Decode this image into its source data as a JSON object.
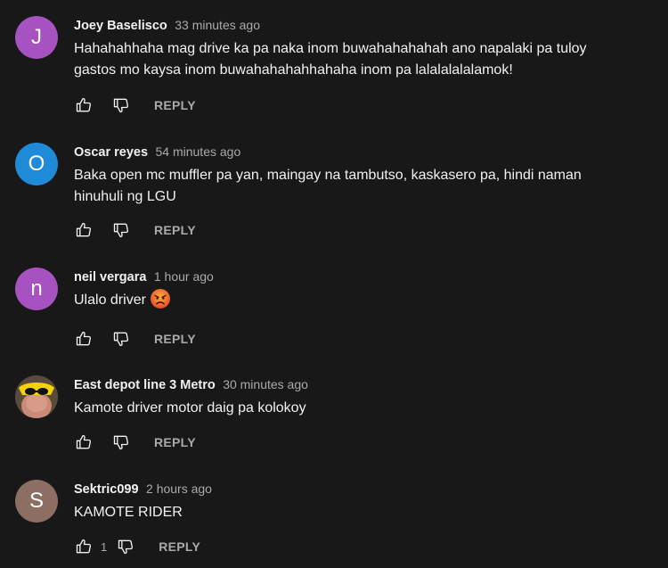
{
  "comments": [
    {
      "author": "Joey Baselisco",
      "time": "33 minutes ago",
      "text_lines": [
        "Hahahahhaha mag drive ka pa naka inom buwahahahahah ano napalaki pa tuloy",
        "gastos mo kaysa inom buwahahahahhahaha inom pa lalalalalalamok!"
      ],
      "avatar_letter": "J",
      "avatar_color": "#a652c1",
      "reply_label": "REPLY"
    },
    {
      "author": "Oscar reyes",
      "time": "54 minutes ago",
      "text_lines": [
        "Baka open mc muffler pa yan, maingay na tambutso, kaskasero pa, hindi naman",
        "hinuhuli ng LGU"
      ],
      "avatar_letter": "O",
      "avatar_color": "#1f8bd8",
      "reply_label": "REPLY"
    },
    {
      "author": "neil vergara",
      "time": "1 hour ago",
      "text_lines": [
        "Ulalo driver"
      ],
      "emoji": "angry-face-emoji",
      "avatar_letter": "n",
      "avatar_color": "#a652c1",
      "reply_label": "REPLY"
    },
    {
      "author": "East depot line 3 Metro",
      "time": "30 minutes ago",
      "text_lines": [
        "Kamote driver motor daig pa kolokoy"
      ],
      "avatar_icon": "photo-avatar",
      "reply_label": "REPLY"
    },
    {
      "author": "Sektric099",
      "time": "2 hours ago",
      "text_lines": [
        "KAMOTE RIDER"
      ],
      "avatar_letter": "S",
      "avatar_color": "#8d6e63",
      "like_count": "1",
      "reply_label": "REPLY"
    }
  ],
  "icons": {
    "like": "thumbs-up-icon",
    "dislike": "thumbs-down-icon"
  }
}
